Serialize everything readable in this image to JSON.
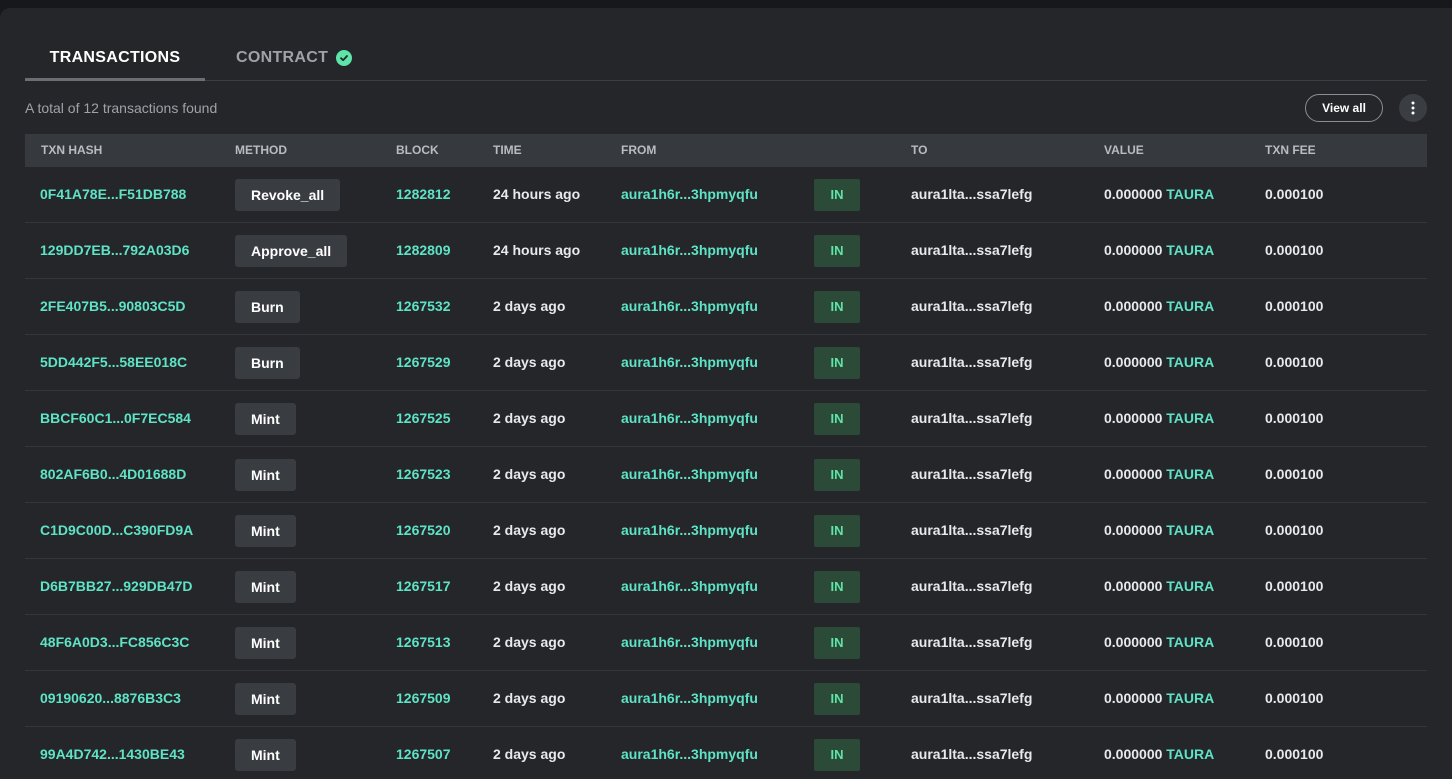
{
  "tabs": {
    "transactions": "TRANSACTIONS",
    "contract": "CONTRACT"
  },
  "summary": "A total of 12 transactions found",
  "view_all": "View all",
  "columns": [
    "TXN HASH",
    "METHOD",
    "BLOCK",
    "TIME",
    "FROM",
    "TO",
    "VALUE",
    "TXN FEE"
  ],
  "denom": "TAURA",
  "colors": {
    "accent": "#5ee3c6",
    "success": "#5ee3a8",
    "panel": "#242629"
  },
  "rows": [
    {
      "hash": "0F41A78E...F51DB788",
      "method": "Revoke_all",
      "block": "1282812",
      "time": "24 hours ago",
      "from": "aura1h6r...3hpmyqfu",
      "dir": "IN",
      "to": "aura1lta...ssa7lefg",
      "value": "0.000000",
      "fee": "0.000100"
    },
    {
      "hash": "129DD7EB...792A03D6",
      "method": "Approve_all",
      "block": "1282809",
      "time": "24 hours ago",
      "from": "aura1h6r...3hpmyqfu",
      "dir": "IN",
      "to": "aura1lta...ssa7lefg",
      "value": "0.000000",
      "fee": "0.000100"
    },
    {
      "hash": "2FE407B5...90803C5D",
      "method": "Burn",
      "block": "1267532",
      "time": "2 days ago",
      "from": "aura1h6r...3hpmyqfu",
      "dir": "IN",
      "to": "aura1lta...ssa7lefg",
      "value": "0.000000",
      "fee": "0.000100"
    },
    {
      "hash": "5DD442F5...58EE018C",
      "method": "Burn",
      "block": "1267529",
      "time": "2 days ago",
      "from": "aura1h6r...3hpmyqfu",
      "dir": "IN",
      "to": "aura1lta...ssa7lefg",
      "value": "0.000000",
      "fee": "0.000100"
    },
    {
      "hash": "BBCF60C1...0F7EC584",
      "method": "Mint",
      "block": "1267525",
      "time": "2 days ago",
      "from": "aura1h6r...3hpmyqfu",
      "dir": "IN",
      "to": "aura1lta...ssa7lefg",
      "value": "0.000000",
      "fee": "0.000100"
    },
    {
      "hash": "802AF6B0...4D01688D",
      "method": "Mint",
      "block": "1267523",
      "time": "2 days ago",
      "from": "aura1h6r...3hpmyqfu",
      "dir": "IN",
      "to": "aura1lta...ssa7lefg",
      "value": "0.000000",
      "fee": "0.000100"
    },
    {
      "hash": "C1D9C00D...C390FD9A",
      "method": "Mint",
      "block": "1267520",
      "time": "2 days ago",
      "from": "aura1h6r...3hpmyqfu",
      "dir": "IN",
      "to": "aura1lta...ssa7lefg",
      "value": "0.000000",
      "fee": "0.000100"
    },
    {
      "hash": "D6B7BB27...929DB47D",
      "method": "Mint",
      "block": "1267517",
      "time": "2 days ago",
      "from": "aura1h6r...3hpmyqfu",
      "dir": "IN",
      "to": "aura1lta...ssa7lefg",
      "value": "0.000000",
      "fee": "0.000100"
    },
    {
      "hash": "48F6A0D3...FC856C3C",
      "method": "Mint",
      "block": "1267513",
      "time": "2 days ago",
      "from": "aura1h6r...3hpmyqfu",
      "dir": "IN",
      "to": "aura1lta...ssa7lefg",
      "value": "0.000000",
      "fee": "0.000100"
    },
    {
      "hash": "09190620...8876B3C3",
      "method": "Mint",
      "block": "1267509",
      "time": "2 days ago",
      "from": "aura1h6r...3hpmyqfu",
      "dir": "IN",
      "to": "aura1lta...ssa7lefg",
      "value": "0.000000",
      "fee": "0.000100"
    },
    {
      "hash": "99A4D742...1430BE43",
      "method": "Mint",
      "block": "1267507",
      "time": "2 days ago",
      "from": "aura1h6r...3hpmyqfu",
      "dir": "IN",
      "to": "aura1lta...ssa7lefg",
      "value": "0.000000",
      "fee": "0.000100"
    }
  ]
}
